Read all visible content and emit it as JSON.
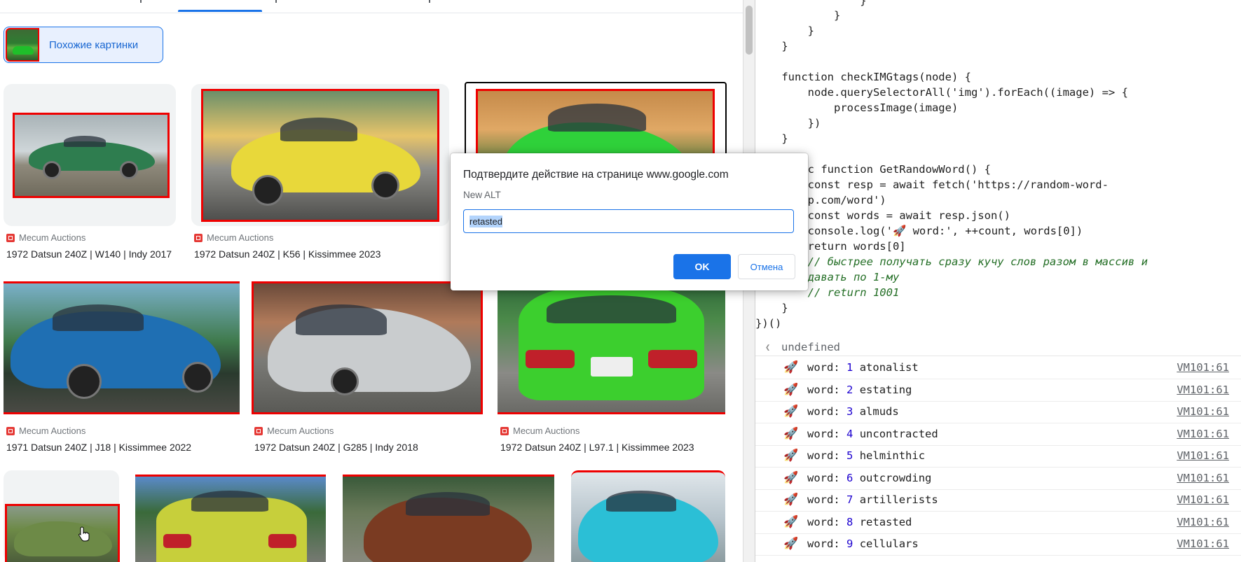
{
  "similar_images": {
    "label": "Похожие картинки"
  },
  "results": [
    {
      "source": "Mecum Auctions",
      "title": "1972 Datsun 240Z | W140 | Indy 2017",
      "car_color": "#2e7d4f"
    },
    {
      "source": "Mecum Auctions",
      "title": "1972 Datsun 240Z | K56 | Kissimmee 2023",
      "car_color": "#e8d83a"
    },
    {
      "source": "",
      "title": "",
      "car_color": "#2fd13a"
    },
    {
      "source": "Mecum Auctions",
      "title": "1971 Datsun 240Z | J18 | Kissimmee 2022",
      "car_color": "#1f6fb3"
    },
    {
      "source": "Mecum Auctions",
      "title": "1972 Datsun 240Z | G285 | Indy 2018",
      "car_color": "#c9ccce"
    },
    {
      "source": "Mecum Auctions",
      "title": "1972 Datsun 240Z | L97.1 | Kissimmee 2023",
      "car_color": "#3ccf2e"
    },
    {
      "source": "",
      "title": "",
      "car_color": "#6d8a47"
    },
    {
      "source": "",
      "title": "",
      "car_color": "#c7cf3b"
    },
    {
      "source": "",
      "title": "",
      "car_color": "#7a3b22"
    },
    {
      "source": "",
      "title": "",
      "car_color": "#2bbfd6"
    }
  ],
  "dialog": {
    "title": "Подтвердите действие на странице www.google.com",
    "label": "New ALT",
    "input_value": "retasted",
    "ok_label": "OK",
    "cancel_label": "Отмена"
  },
  "console": {
    "code_lines": [
      "                }",
      "            }",
      "        }",
      "    }",
      "",
      "    function checkIMGtags(node) {",
      "        node.querySelectorAll('img').forEach((image) => {",
      "            processImage(image)",
      "        })",
      "    }",
      "",
      "    async function GetRandowWord() {",
      "        const resp = await fetch('https://random-word-",
      "herokuapp.com/word')",
      "        const words = await resp.json()",
      "        console.log('🚀 word:', ++count, words[0])",
      "        return words[0]",
      "        // быстрее получать сразу кучу слов разом в массив и",
      "потом выдавать по 1-му",
      "        // return 1001",
      "    }",
      "})()"
    ],
    "result": "undefined",
    "log_prefix": "word:",
    "log_link": "VM101:61",
    "rocket_icon": "🚀",
    "logs": [
      {
        "n": "1",
        "word": "atonalist"
      },
      {
        "n": "2",
        "word": "estating"
      },
      {
        "n": "3",
        "word": "almuds"
      },
      {
        "n": "4",
        "word": "uncontracted"
      },
      {
        "n": "5",
        "word": "helminthic"
      },
      {
        "n": "6",
        "word": "outcrowding"
      },
      {
        "n": "7",
        "word": "artillerists"
      },
      {
        "n": "8",
        "word": "retasted"
      },
      {
        "n": "9",
        "word": "cellulars"
      }
    ]
  }
}
